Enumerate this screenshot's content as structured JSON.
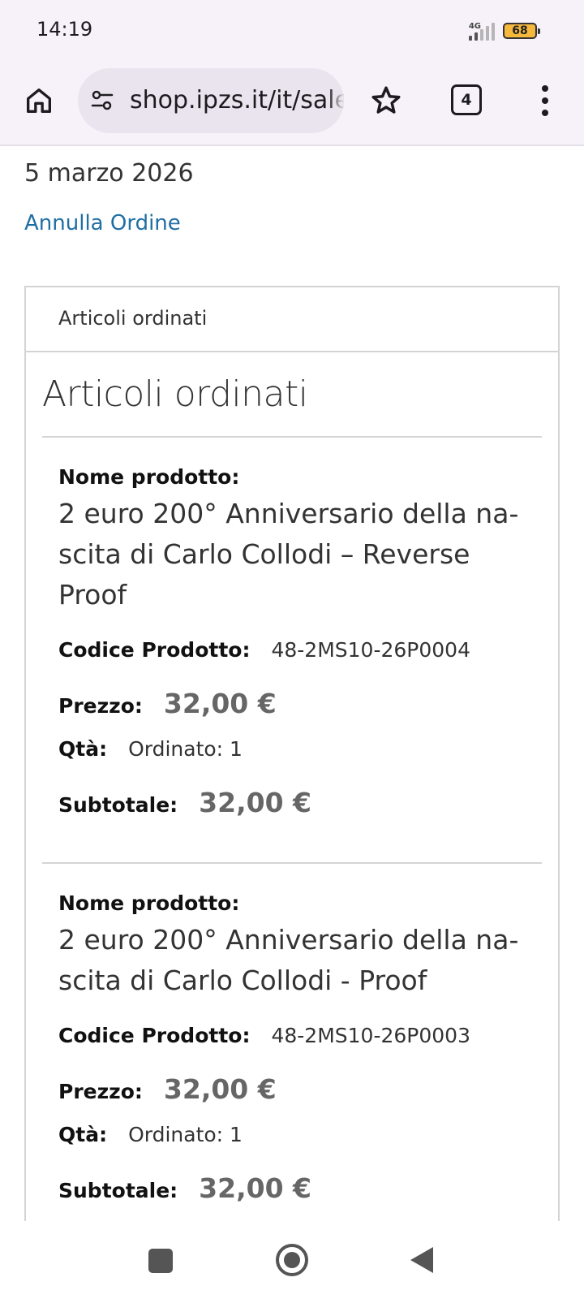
{
  "status_bar": {
    "time": "14:19",
    "network": "4G",
    "battery": "68"
  },
  "browser": {
    "url": "shop.ipzs.it/it/sales/order/view",
    "tab_count": "4"
  },
  "order": {
    "date": "5 marzo 2026",
    "cancel_link": "Annulla Ordine",
    "panel_tab": "Articoli ordinati",
    "section_title": "Articoli ordinati",
    "labels": {
      "product_name": "Nome prodotto:",
      "sku": "Codice Prodotto:",
      "price": "Prezzo:",
      "qty": "Qtà:",
      "subtotal": "Subtotale:"
    },
    "items": [
      {
        "name": "2 euro 200° Anniversario della na-scita di Carlo Collodi – Reverse Proof",
        "sku": "48-2MS10-26P0004",
        "price": "32,00 €",
        "qty": "Ordinato: 1",
        "subtotal": "32,00 €"
      },
      {
        "name": "2 euro 200° Anniversario della na-scita di Carlo Collodi - Proof",
        "sku": "48-2MS10-26P0003",
        "price": "32,00 €",
        "qty": "Ordinato: 1",
        "subtotal": "32,00 €"
      }
    ]
  },
  "colors": {
    "chrome_bg": "#f7f2fa",
    "url_pill_bg": "#e9e4ed",
    "link": "#1f6fa3",
    "price_text": "#666666",
    "battery_fill": "#f5b83d"
  },
  "icons": {
    "home": "home-icon",
    "site_settings": "tune-icon",
    "bookmark": "star-icon",
    "menu": "more-vert-icon",
    "nav_recents": "square-icon",
    "nav_home": "circle-icon",
    "nav_back": "triangle-back-icon"
  }
}
